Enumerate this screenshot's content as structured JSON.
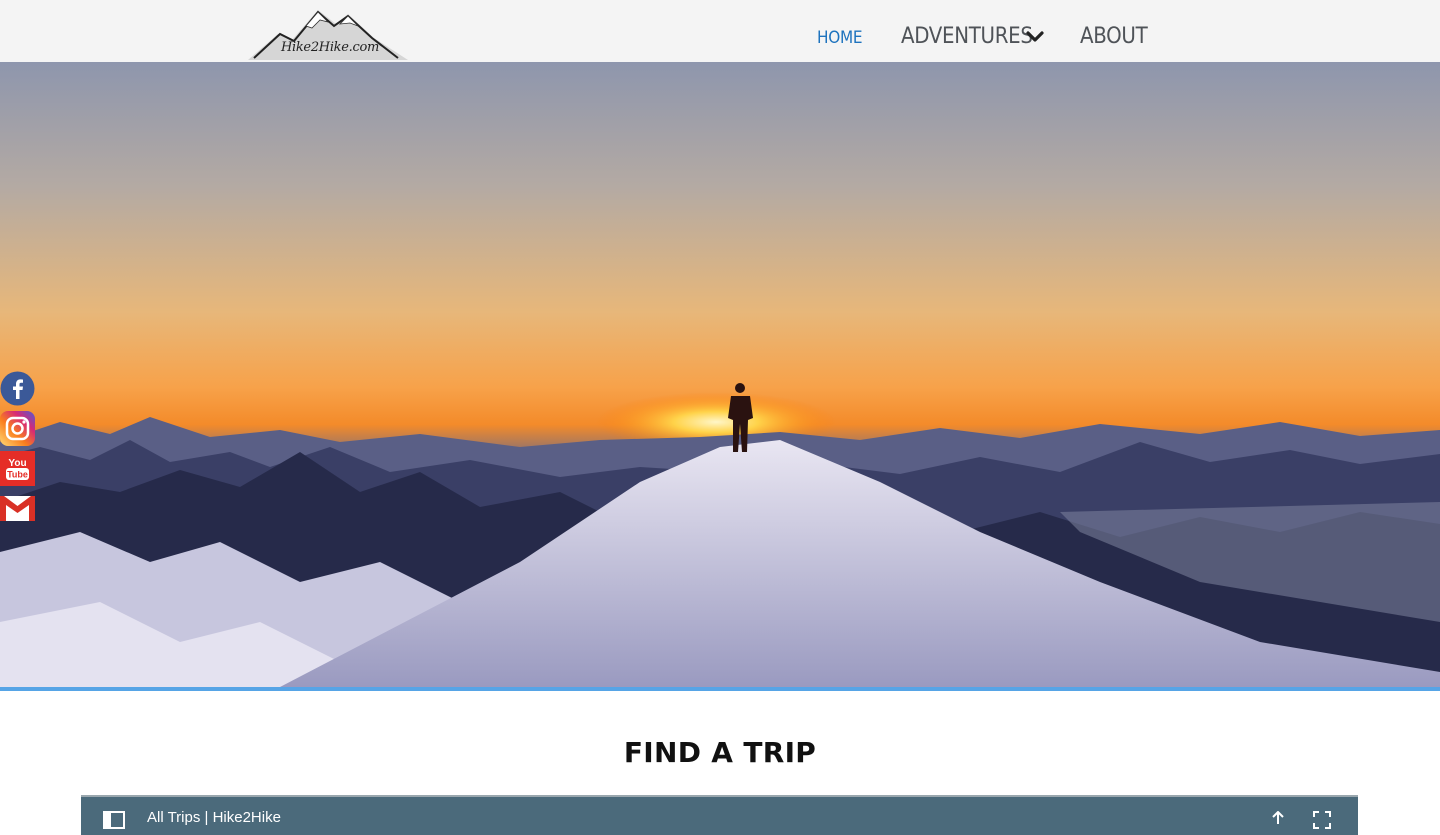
{
  "logo": {
    "text": "Hike2Hike.com"
  },
  "nav": {
    "home": "HOME",
    "adventures": "ADVENTURES",
    "about": "ABOUT"
  },
  "social": [
    "facebook-icon",
    "instagram-icon",
    "youtube-icon",
    "gmail-icon"
  ],
  "find_trip": {
    "title": "FIND A TRIP",
    "map_title": "All Trips | Hike2Hike"
  },
  "colors": {
    "nav_active": "#1e73be",
    "nav_text": "#4f5358",
    "accent_bar": "#56a4e6",
    "map_bar": "#4b6a7b"
  }
}
